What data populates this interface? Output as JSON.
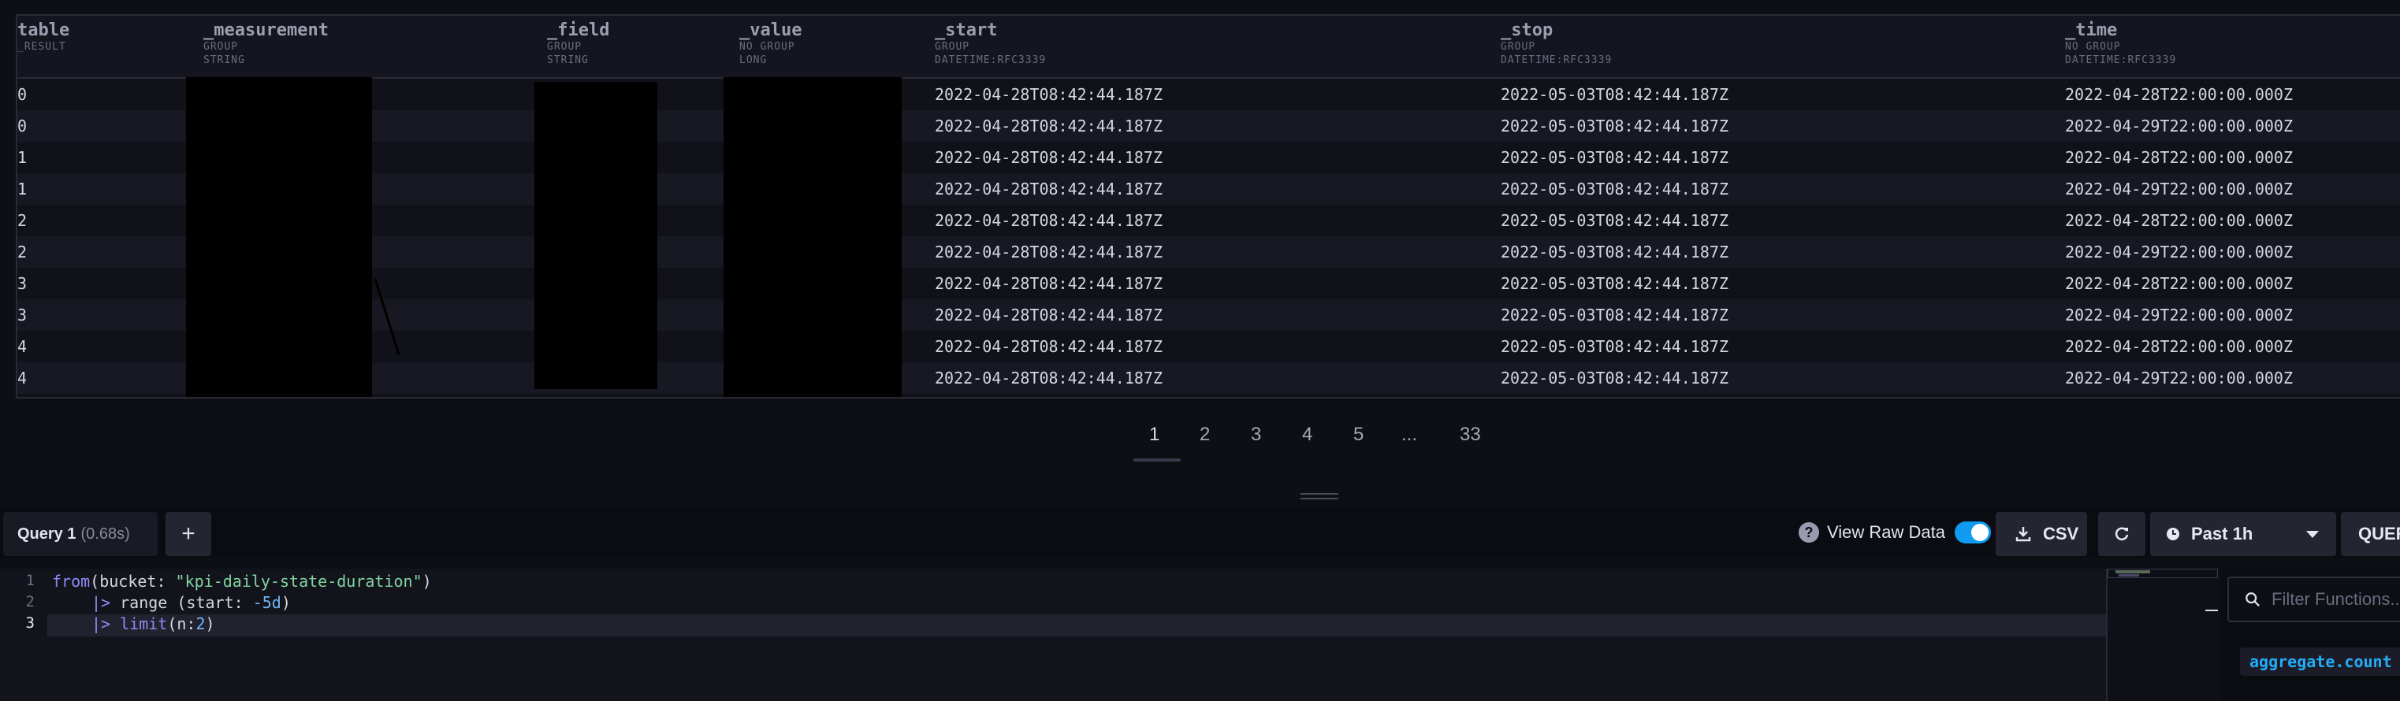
{
  "table": {
    "columns": [
      {
        "name": "table",
        "meta1": "_RESULT",
        "meta2": ""
      },
      {
        "name": "_measurement",
        "meta1": "GROUP",
        "meta2": "STRING"
      },
      {
        "name": "_field",
        "meta1": "GROUP",
        "meta2": "STRING"
      },
      {
        "name": "_value",
        "meta1": "NO GROUP",
        "meta2": "LONG"
      },
      {
        "name": "_start",
        "meta1": "GROUP",
        "meta2": "DATETIME:RFC3339"
      },
      {
        "name": "_stop",
        "meta1": "GROUP",
        "meta2": "DATETIME:RFC3339"
      },
      {
        "name": "_time",
        "meta1": "NO GROUP",
        "meta2": "DATETIME:RFC3339"
      }
    ],
    "rows": [
      {
        "table": "0",
        "start": "2022-04-28T08:42:44.187Z",
        "stop": "2022-05-03T08:42:44.187Z",
        "time": "2022-04-28T22:00:00.000Z"
      },
      {
        "table": "0",
        "start": "2022-04-28T08:42:44.187Z",
        "stop": "2022-05-03T08:42:44.187Z",
        "time": "2022-04-29T22:00:00.000Z"
      },
      {
        "table": "1",
        "start": "2022-04-28T08:42:44.187Z",
        "stop": "2022-05-03T08:42:44.187Z",
        "time": "2022-04-28T22:00:00.000Z"
      },
      {
        "table": "1",
        "start": "2022-04-28T08:42:44.187Z",
        "stop": "2022-05-03T08:42:44.187Z",
        "time": "2022-04-29T22:00:00.000Z"
      },
      {
        "table": "2",
        "start": "2022-04-28T08:42:44.187Z",
        "stop": "2022-05-03T08:42:44.187Z",
        "time": "2022-04-28T22:00:00.000Z"
      },
      {
        "table": "2",
        "start": "2022-04-28T08:42:44.187Z",
        "stop": "2022-05-03T08:42:44.187Z",
        "time": "2022-04-29T22:00:00.000Z"
      },
      {
        "table": "3",
        "start": "2022-04-28T08:42:44.187Z",
        "stop": "2022-05-03T08:42:44.187Z",
        "time": "2022-04-28T22:00:00.000Z"
      },
      {
        "table": "3",
        "start": "2022-04-28T08:42:44.187Z",
        "stop": "2022-05-03T08:42:44.187Z",
        "time": "2022-04-29T22:00:00.000Z"
      },
      {
        "table": "4",
        "start": "2022-04-28T08:42:44.187Z",
        "stop": "2022-05-03T08:42:44.187Z",
        "time": "2022-04-28T22:00:00.000Z"
      },
      {
        "table": "4",
        "start": "2022-04-28T08:42:44.187Z",
        "stop": "2022-05-03T08:42:44.187Z",
        "time": "2022-04-29T22:00:00.000Z"
      }
    ]
  },
  "pagination": {
    "pages": [
      "1",
      "2",
      "3",
      "4",
      "5",
      "...",
      "33"
    ],
    "current": "1"
  },
  "toolbar": {
    "query_tab_name": "Query 1",
    "query_tab_time": "(0.68s)",
    "add_tab": "+",
    "help_icon": "?",
    "raw_data_label": "View Raw Data",
    "raw_data_on": true,
    "csv_label": "CSV",
    "time_range": "Past 1h",
    "query_label": "QUER"
  },
  "editor": {
    "line_numbers": [
      "1",
      "2",
      "3"
    ],
    "line1": {
      "fn": "from",
      "open": "(bucket: ",
      "str": "\"kpi-daily-state-duration\"",
      "close": ")"
    },
    "line2": {
      "pipe": "|>",
      "fn": " range (start: ",
      "num": "-5d",
      "close": ")"
    },
    "line3": {
      "pipe": "|>",
      "fn": " limit",
      "open": "(n:",
      "num": "2",
      "close": ")"
    }
  },
  "functions_panel": {
    "filter_placeholder": "Filter Functions...",
    "first_function": "aggregate.count"
  },
  "colors": {
    "accent": "#0f9cf0",
    "function_chip": "#22adf6",
    "background": "#0e0e15"
  },
  "icons": {
    "prev": "caret-left-icon",
    "next": "caret-right-icon",
    "download": "download-icon",
    "refresh": "refresh-icon",
    "clock": "clock-icon",
    "dropdown": "chevron-down-icon",
    "search": "search-icon"
  }
}
